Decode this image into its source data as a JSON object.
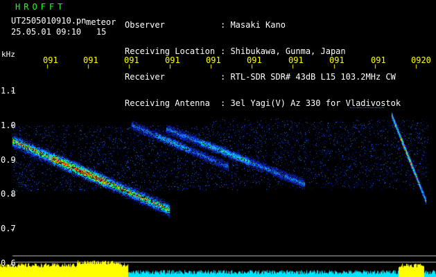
{
  "station": {
    "brand": "HROFFT",
    "filename": "UT2505010910.pn",
    "file_tag": "meteor",
    "datetime": "25.05.01 09:10",
    "interval": "15"
  },
  "info": [
    {
      "label": "Observer",
      "value": "Masaki Kano"
    },
    {
      "label": "Receiving Location",
      "value": "Shibukawa, Gunma, Japan"
    },
    {
      "label": "Receiver",
      "value": "RTL-SDR SDR# 43dB L15 103.2MHz CW"
    },
    {
      "label": "Receiving Antenna",
      "value": "3el Yagi(V) Az 330 for Vladivostok"
    }
  ],
  "axis": {
    "unit": "kHz",
    "time_ticks": [
      "091",
      "091",
      "091",
      "091",
      "091",
      "091",
      "091",
      "091",
      "091",
      "0920"
    ],
    "freq_ticks": [
      "1.1",
      "1.0",
      "0.9",
      "0.8",
      "0.7",
      "0.6"
    ]
  },
  "colors": {
    "text": "#ffffff",
    "brand": "#22ff22",
    "ticks": "#ffff00",
    "power_bar": "#ffff00",
    "noise_bar": "#00e5ff",
    "background": "#000000"
  }
}
